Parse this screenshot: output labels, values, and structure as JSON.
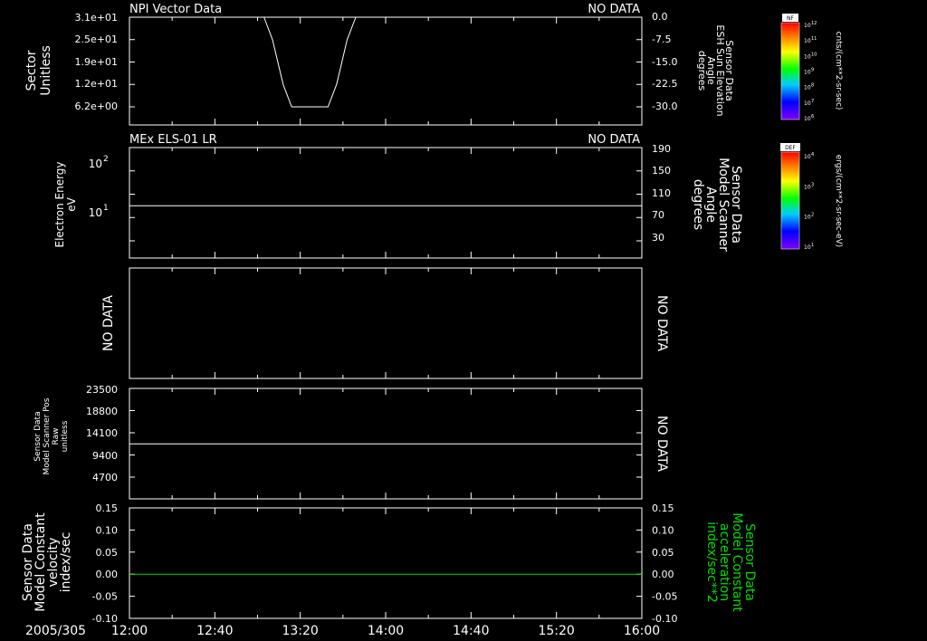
{
  "figure": {
    "date_label": "2005/305",
    "time_ticks": [
      "12:00",
      "12:40",
      "13:20",
      "14:00",
      "14:40",
      "15:20",
      "16:00"
    ],
    "colors": {
      "background": "#000000",
      "foreground": "#ffffff",
      "green": "#00dd00"
    }
  },
  "panels": {
    "p1": {
      "title": "NPI Vector Data",
      "status": "NO DATA",
      "left_label": [
        "Sector",
        "Unitless"
      ],
      "left_ticks": [
        "3.1e+01",
        "2.5e+01",
        "1.9e+01",
        "1.2e+01",
        "6.2e+00"
      ],
      "right_ticks": [
        "0.0",
        "-7.5",
        "-15.0",
        "-22.5",
        "-30.0"
      ],
      "right_label": [
        "Sensor Data",
        "ESH Sun Elevation",
        "Angle",
        "degrees"
      ]
    },
    "p2": {
      "title": "MEx ELS-01 LR",
      "status": "NO DATA",
      "left_label": [
        "Electron Energy",
        "eV"
      ],
      "left_ticks": [
        "10",
        "2",
        "10",
        "1"
      ],
      "right_ticks": [
        "190",
        "150",
        "110",
        "70",
        "30"
      ],
      "right_label": [
        "Sensor Data",
        "Model Scanner",
        "Angle",
        "degrees"
      ]
    },
    "p3": {
      "left_label": "NO DATA",
      "right_label": "NO DATA"
    },
    "p4": {
      "left_label": [
        "Sensor Data",
        "Model Scanner Pos",
        "Raw",
        "unitless"
      ],
      "left_ticks": [
        "23500",
        "18800",
        "14100",
        "9400",
        "4700"
      ],
      "right_label": "NO DATA"
    },
    "p5": {
      "left_label": [
        "Sensor Data",
        "Model Constant",
        "velocity",
        "index/sec"
      ],
      "left_ticks": [
        "0.15",
        "0.10",
        "0.05",
        "0.00",
        "-0.05",
        "-0.10"
      ],
      "right_ticks": [
        "0.15",
        "0.10",
        "0.05",
        "0.00",
        "-0.05",
        "-0.10"
      ],
      "right_label": [
        "Sensor Data",
        "Model Constant",
        "acceleration",
        "index/sec**2"
      ]
    }
  },
  "colorbars": {
    "nf": {
      "tag": "NF",
      "ticks": [
        "10",
        "12",
        "10",
        "11",
        "10",
        "10",
        "10",
        "9",
        "10",
        "8",
        "10",
        "7",
        "10",
        "6"
      ],
      "units": "cnts/(cm**2-sr-sec)"
    },
    "def": {
      "tag": "DEF",
      "ticks": [
        "10",
        "4",
        "10",
        "3",
        "10",
        "2",
        "10",
        "1"
      ],
      "units": "ergs/(cm**2-sr-sec-eV)"
    }
  },
  "chart_data": [
    {
      "type": "line",
      "title": "NPI Vector Data",
      "ylabel": "Sector Unitless",
      "y2label": "Sensor Data ESH Sun Elevation Angle degrees",
      "y2lim": [
        -35,
        0
      ],
      "x": [
        "13:03",
        "13:07",
        "13:12",
        "13:16",
        "13:33",
        "13:37",
        "13:42",
        "13:46"
      ],
      "series": [
        {
          "values": [
            0,
            -7.5,
            -22.5,
            -30.0,
            -30.0,
            -22.5,
            -7.5,
            0
          ]
        }
      ]
    },
    {
      "type": "line",
      "title": "MEx ELS-01 LR",
      "ylabel": "Electron Energy eV",
      "y2label": "Sensor Data Model Scanner Angle degrees",
      "y2lim": [
        0,
        190
      ],
      "x": [
        "12:00",
        "16:00"
      ],
      "series": [
        {
          "values": [
            90,
            90
          ]
        }
      ]
    },
    {
      "type": "line",
      "ylabel": "Sensor Data Model Scanner Pos Raw unitless",
      "ylim": [
        0,
        23500
      ],
      "x": [
        "12:00",
        "16:00"
      ],
      "series": [
        {
          "values": [
            11700,
            11700
          ]
        }
      ]
    },
    {
      "type": "line",
      "ylabel": "Sensor Data Model Constant velocity index/sec",
      "y2label": "Sensor Data Model Constant acceleration index/sec**2",
      "ylim": [
        -0.1,
        0.15
      ],
      "x": [
        "12:00",
        "16:00"
      ],
      "series": [
        {
          "values": [
            0.0,
            0.0
          ]
        }
      ]
    }
  ]
}
